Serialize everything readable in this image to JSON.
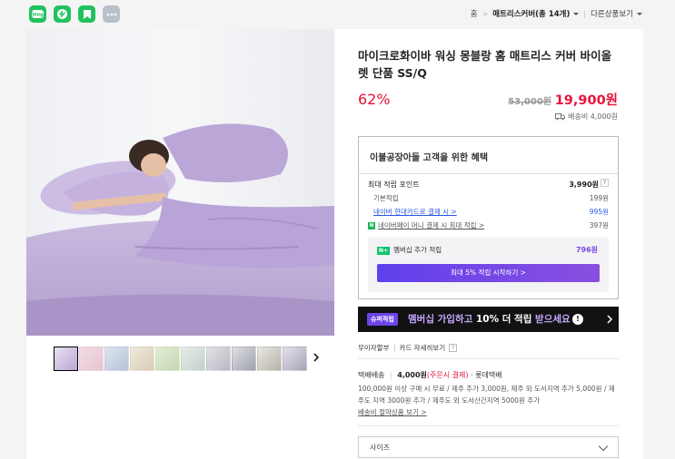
{
  "share": {
    "icons": [
      "blog-share-icon",
      "talk-share-icon",
      "bookmark-share-icon",
      "more-share-icon"
    ],
    "blog_label": "blog"
  },
  "breadcrumb": {
    "home": "홈",
    "category": "매트리스커버(총 14개)",
    "other": "다른상품보기"
  },
  "product": {
    "title": "마이크로화이바 워싱 몽블랑 홈 매트리스 커버 바이올렛 단품 SS/Q",
    "discount": "62%",
    "original_price": "53,000원",
    "sale_price": "19,900원",
    "shipping_fee": "배송비 4,000원",
    "thumbnail_count": 10
  },
  "benefit": {
    "title": "이불공장아들 고객을 위한 혜택",
    "max_points_label": "최대 적립 포인트",
    "max_points_value": "3,990원",
    "help": "?",
    "rows": [
      {
        "label": "기본적립",
        "value": "199원"
      },
      {
        "label": "네이버 현대카드로 결제 시 >",
        "value": "995원"
      },
      {
        "label": "네이버페이 머니 결제 시 최대 적립 >",
        "value": "397원"
      }
    ],
    "npay_badge": "N",
    "membership_badge": "N+",
    "membership_label": "멤버십 추가 적립",
    "membership_value": "796원",
    "membership_button": "최대 5% 적립 시작하기 >"
  },
  "banner": {
    "tag": "슈퍼적립",
    "part1": "멤버십 가입하고 ",
    "part2": "10% 더 적립",
    "part3": " 받으세요",
    "excl": "!"
  },
  "payment": {
    "installment": "무이자할부",
    "card_benefit": "카드 자세히보기",
    "help": "?"
  },
  "shipping": {
    "type": "택배배송",
    "fee": "4,000원",
    "condition": "(주문시 결제)",
    "carrier": "· 롯데택배",
    "desc": "100,000원 이상 구매 시 무료 / 제주 추가 3,000원, 제주 외 도서지역 추가 5,000원 / 제주도 지역 3000원 추가 / 제주도 외 도서산간지역 5000원 추가",
    "link": "배송비 절약상품 보기 >"
  },
  "option": {
    "size_placeholder": "사이즈"
  },
  "colors": {
    "accent_red": "#e5133a",
    "purple": "#6c45e8",
    "naver_green": "#21c25e"
  }
}
